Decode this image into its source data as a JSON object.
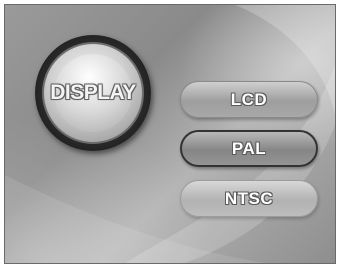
{
  "main_button": {
    "label": "DISPLAY"
  },
  "options": [
    {
      "label": "LCD",
      "state": "normal"
    },
    {
      "label": "PAL",
      "state": "selected"
    },
    {
      "label": "NTSC",
      "state": "normal"
    }
  ],
  "colors": {
    "background": "#9a9a9a",
    "selected_border": "#333333",
    "label_text": "#ffffff"
  }
}
